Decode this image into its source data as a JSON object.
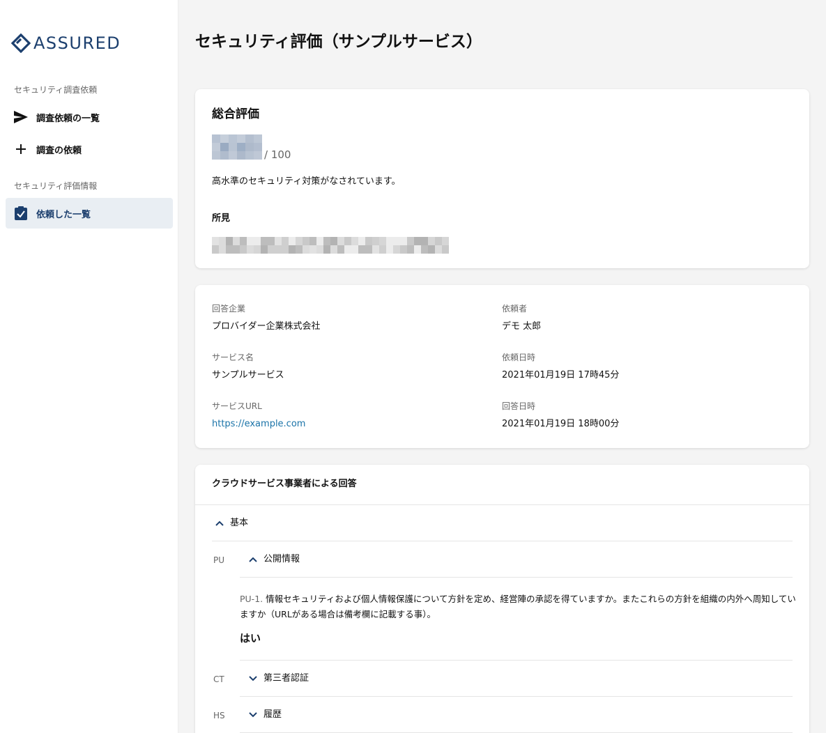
{
  "sidebar": {
    "logo_text": "ASSURED",
    "sections": [
      {
        "title": "セキュリティ調査依頼",
        "items": [
          {
            "label": "調査依頼の一覧",
            "icon": "send-icon"
          },
          {
            "label": "調査の依頼",
            "icon": "plus-icon"
          }
        ]
      },
      {
        "title": "セキュリティ評価情報",
        "items": [
          {
            "label": "依頼した一覧",
            "icon": "clipboard-check-icon",
            "active": true
          }
        ]
      }
    ]
  },
  "main": {
    "title": "セキュリティ評価（サンプルサービス）",
    "overall": {
      "heading": "総合評価",
      "score_max": "/ 100",
      "summary": "高水準のセキュリティ対策がなされています。",
      "findings_label": "所見"
    },
    "details": {
      "respondent_label": "回答企業",
      "respondent_value": "プロバイダー企業株式会社",
      "requester_label": "依頼者",
      "requester_value": "デモ 太郎",
      "service_name_label": "サービス名",
      "service_name_value": "サンプルサービス",
      "request_date_label": "依頼日時",
      "request_date_value": "2021年01月19日 17時45分",
      "service_url_label": "サービスURL",
      "service_url_value": "https://example.com",
      "answer_date_label": "回答日時",
      "answer_date_value": "2021年01月19日 18時00分"
    },
    "answers": {
      "title": "クラウドサービス事業者による回答",
      "group_label": "基本",
      "categories": [
        {
          "code": "PU",
          "label": "公開情報",
          "expanded": true
        },
        {
          "code": "CT",
          "label": "第三者認証",
          "expanded": false
        },
        {
          "code": "HS",
          "label": "履歴",
          "expanded": false
        }
      ],
      "question": {
        "code": "PU-1.",
        "text": "情報セキュリティおよび個人情報保護について方針を定め、経営陣の承認を得ていますか。またこれらの方針を組織の内外へ周知していますか（URLがある場合は備考欄に記載する事）。",
        "answer": "はい"
      }
    }
  },
  "colors": {
    "brand": "#1c3f6e",
    "link": "#1a73a8",
    "active_bg": "#e9eef3",
    "page_bg": "#f4f4f4"
  }
}
